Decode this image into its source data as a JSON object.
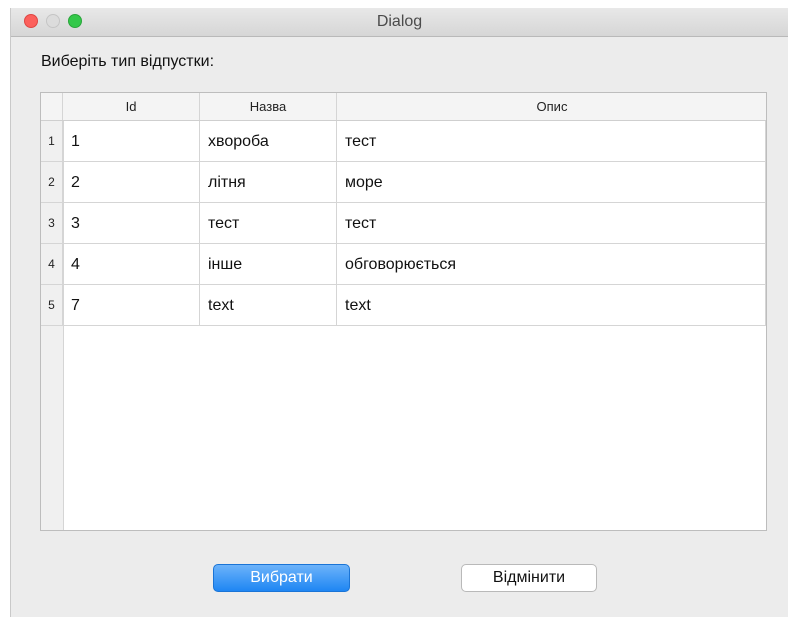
{
  "window": {
    "title": "Dialog"
  },
  "prompt": "Виберіть тип відпустки:",
  "table": {
    "columns": [
      "Id",
      "Назва",
      "Опис"
    ],
    "rows": [
      {
        "num": "1",
        "id": "1",
        "name": "хвороба",
        "desc": "тест"
      },
      {
        "num": "2",
        "id": "2",
        "name": "літня",
        "desc": "море"
      },
      {
        "num": "3",
        "id": "3",
        "name": "тест",
        "desc": "тест"
      },
      {
        "num": "4",
        "id": "4",
        "name": "інше",
        "desc": "обговорюється"
      },
      {
        "num": "5",
        "id": "7",
        "name": "text",
        "desc": "text"
      }
    ]
  },
  "buttons": {
    "select": "Вибрати",
    "cancel": "Відмінити"
  },
  "colors": {
    "primary": "#1e86f3",
    "close": "#fc605c",
    "maximize": "#34c84a"
  }
}
